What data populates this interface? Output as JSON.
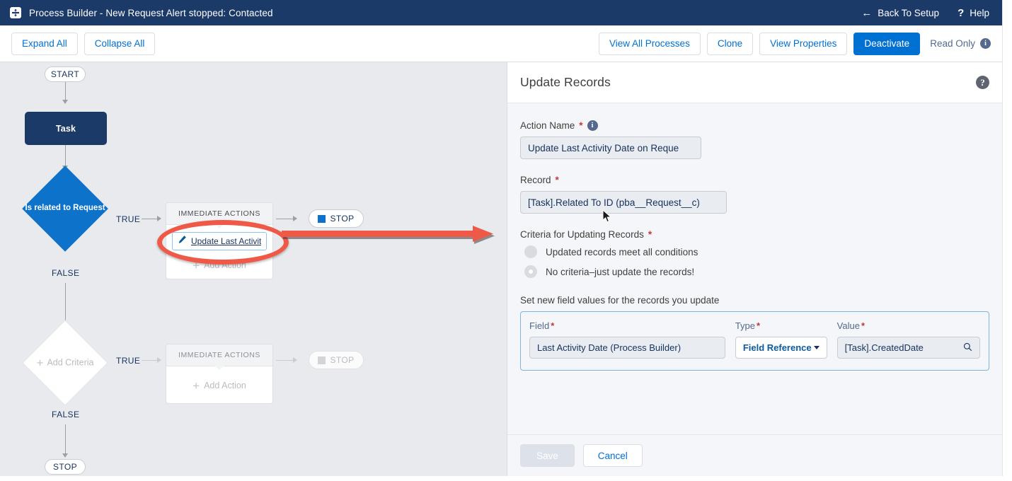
{
  "titlebar": {
    "icon": "process-builder-icon",
    "title": "Process Builder - New Request Alert stopped: Contacted",
    "back_label": "Back To Setup",
    "back_icon": "arrow-left-icon",
    "help_label": "Help",
    "help_icon": "question-mark-icon"
  },
  "toolbar": {
    "expand_all": "Expand All",
    "collapse_all": "Collapse All",
    "view_all_processes": "View All Processes",
    "clone": "Clone",
    "view_properties": "View Properties",
    "deactivate": "Deactivate",
    "read_only": "Read Only",
    "read_only_info_icon": "info-icon"
  },
  "canvas": {
    "start_label": "START",
    "task_label": "Task",
    "criteria1_label": "Is related to Request",
    "criteria1_true": "TRUE",
    "criteria1_false": "FALSE",
    "criteria2_label": "Add Criteria",
    "criteria2_true": "TRUE",
    "criteria2_false": "FALSE",
    "immediate_actions_1": "IMMEDIATE ACTIONS",
    "immediate_actions_2": "IMMEDIATE ACTIONS",
    "action_item_label": "Update Last Activit...",
    "action_item_icon": "pencil-icon",
    "add_action_1": "Add Action",
    "add_action_2": "Add Action",
    "stop_1": "STOP",
    "stop_2": "STOP",
    "stop_3": "STOP",
    "annotation_oval": "red-highlight-oval",
    "annotation_arrow": "red-pointer-arrow"
  },
  "panel": {
    "title": "Update Records",
    "help_icon": "help-icon",
    "action_name": {
      "label": "Action Name",
      "required": "*",
      "info_icon": "info-icon",
      "value": "Update Last Activity Date on Reque"
    },
    "record": {
      "label": "Record",
      "required": "*",
      "value": "[Task].Related To ID (pba__Request__c)"
    },
    "criteria": {
      "label": "Criteria for Updating Records",
      "required": "*",
      "options": [
        {
          "label": "Updated records meet all conditions",
          "selected": false
        },
        {
          "label": "No criteria–just update the records!",
          "selected": true
        }
      ]
    },
    "set_new_values": {
      "label": "Set new field values for the records you update",
      "columns": [
        {
          "header": "Field",
          "required": "*"
        },
        {
          "header": "Type",
          "required": "*"
        },
        {
          "header": "Value",
          "required": "*"
        }
      ],
      "row": {
        "field": "Last Activity Date (Process Builder)",
        "type": "Field Reference",
        "type_caret_icon": "chevron-down-icon",
        "value": "[Task].CreatedDate",
        "value_search_icon": "search-icon"
      }
    },
    "footer": {
      "save": "Save",
      "cancel": "Cancel"
    }
  },
  "colors": {
    "brand_navy": "#1B3A68",
    "brand_blue": "#0070d2",
    "node_blue": "#0d72c9",
    "annotation_red": "#ef5a48",
    "canvas_bg": "#e8eaed",
    "panel_bg": "#f4f6f9",
    "required_red": "#c23934"
  }
}
